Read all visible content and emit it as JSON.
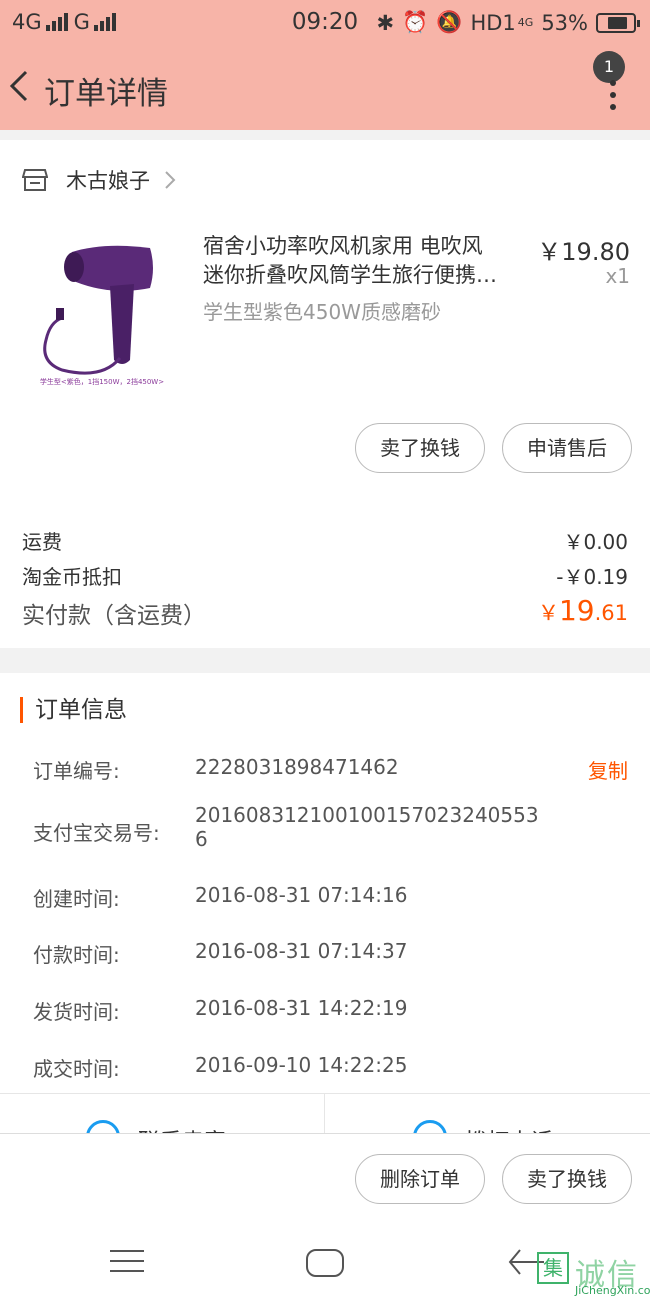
{
  "status_bar": {
    "network1": "4G",
    "network2": "G",
    "time": "09:20",
    "hd": "HD1",
    "net_small": "4G",
    "battery": "53%"
  },
  "nav": {
    "title": "订单详情",
    "badge_count": "1"
  },
  "shop": {
    "name": "木古娘子"
  },
  "product": {
    "title_line1": "宿舍小功率吹风机家用 电吹风",
    "title_line2": "迷你折叠吹风筒学生旅行便携…",
    "sku": "学生型紫色450W质感磨砂",
    "price": "￥19.80",
    "qty": "x1",
    "image_caption": "学生型<紫色，1挡150W，2挡450W>",
    "buttons": {
      "sell": "卖了换钱",
      "after_sale": "申请售后"
    }
  },
  "fees": {
    "shipping_label": "运费",
    "shipping_value": "￥0.00",
    "coin_label": "淘金币抵扣",
    "coin_value": "-￥0.19",
    "paid_label": "实付款（含运费）",
    "paid_currency": "￥",
    "paid_int": "19",
    "paid_dec": ".61"
  },
  "order_info": {
    "heading": "订单信息",
    "copy_label": "复制",
    "rows": [
      {
        "label": "订单编号:",
        "value": "2228031898471462"
      },
      {
        "label": "支付宝交易号:",
        "value": "2016083121001001570232405536"
      },
      {
        "label": "创建时间:",
        "value": "2016-08-31 07:14:16"
      },
      {
        "label": "付款时间:",
        "value": "2016-08-31 07:14:37"
      },
      {
        "label": "发货时间:",
        "value": "2016-08-31 14:22:19"
      },
      {
        "label": "成交时间:",
        "value": "2016-09-10 14:22:25"
      }
    ]
  },
  "contact": {
    "seller_label": "联系卖家",
    "phone_label": "拨打电话"
  },
  "actions": {
    "delete": "删除订单",
    "sell": "卖了换钱"
  },
  "watermark": {
    "box": "集",
    "text": "诚信",
    "sub": "JiChengXin.com"
  },
  "colors": {
    "header_bg": "#f7b4a8",
    "accent": "#ff5500",
    "phone_icon": "#1a9cf0"
  }
}
